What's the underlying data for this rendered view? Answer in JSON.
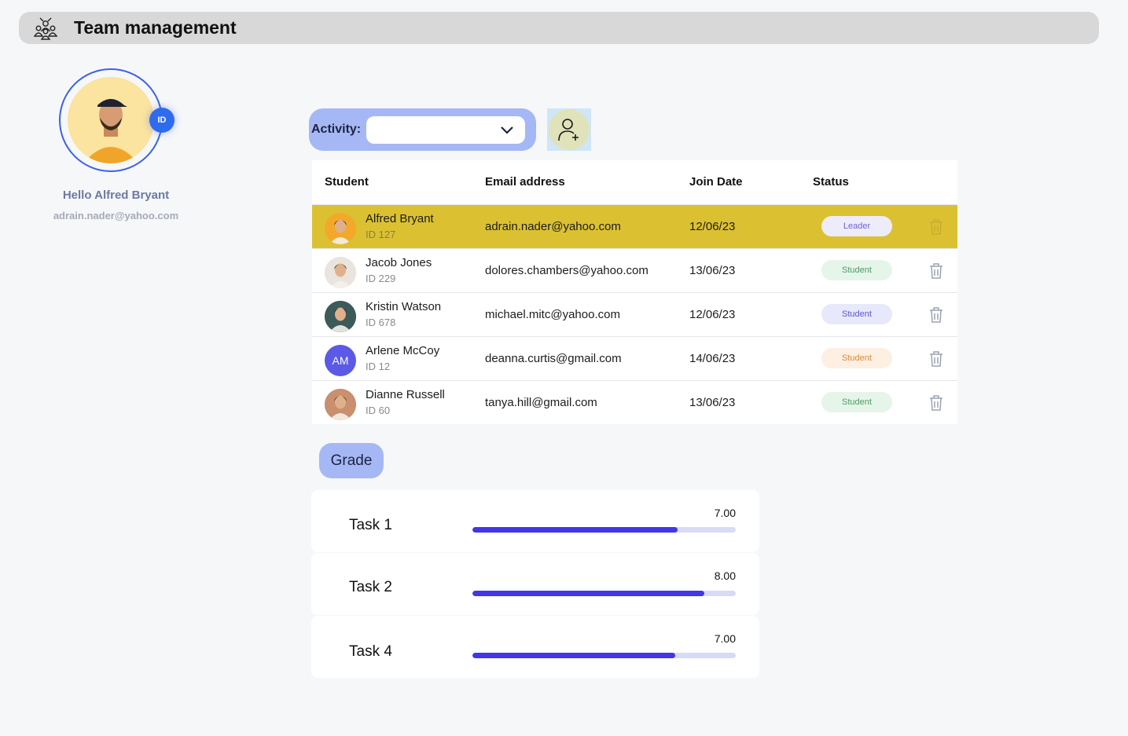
{
  "header": {
    "title": "Team management",
    "icon": "team-icon"
  },
  "profile": {
    "badge": "ID",
    "greeting": "Hello Alfred Bryant",
    "email": "adrain.nader@yahoo.com"
  },
  "activity": {
    "label": "Activity:",
    "value": ""
  },
  "table": {
    "headers": {
      "student": "Student",
      "email": "Email address",
      "date": "Join Date",
      "status": "Status"
    },
    "rows": [
      {
        "name": "Alfred Bryant",
        "id": "ID 127",
        "email": "adrain.nader@yahoo.com",
        "date": "12/06/23",
        "status": "Leader",
        "status_bg": "#eeecfb",
        "status_fg": "#6b63d6",
        "avatar": "photo",
        "avatar_bg": "#f2a92a",
        "initials": ""
      },
      {
        "name": "Jacob Jones",
        "id": "ID 229",
        "email": "dolores.chambers@yahoo.com",
        "date": "13/06/23",
        "status": "Student",
        "status_bg": "#e6f5ea",
        "status_fg": "#4f9a62",
        "avatar": "photo",
        "avatar_bg": "#e9e4de",
        "initials": ""
      },
      {
        "name": "Kristin Watson",
        "id": "ID 678",
        "email": "michael.mitc@yahoo.com",
        "date": "12/06/23",
        "status": "Student",
        "status_bg": "#e8e8fb",
        "status_fg": "#5a55cf",
        "avatar": "photo",
        "avatar_bg": "#3c5a5a",
        "initials": ""
      },
      {
        "name": "Arlene McCoy",
        "id": "ID 12",
        "email": "deanna.curtis@gmail.com",
        "date": "14/06/23",
        "status": "Student",
        "status_bg": "#fdf0e2",
        "status_fg": "#d78a3c",
        "avatar": "initials",
        "avatar_bg": "#5b5ae6",
        "initials": "AM"
      },
      {
        "name": "Dianne Russell",
        "id": "ID 60",
        "email": "tanya.hill@gmail.com",
        "date": "13/06/23",
        "status": "Student",
        "status_bg": "#e6f5ea",
        "status_fg": "#4f9a62",
        "avatar": "photo",
        "avatar_bg": "#c98f6e",
        "initials": ""
      }
    ]
  },
  "grade": {
    "label": "Grade",
    "tasks": [
      {
        "name": "Task 1",
        "value": "7.00",
        "progress": 0.78
      },
      {
        "name": "Task 2",
        "value": "8.00",
        "progress": 0.88
      },
      {
        "name": "Task 4",
        "value": "7.00",
        "progress": 0.77
      }
    ]
  },
  "colors": {
    "accent": "#3b62e6",
    "highlight_row": "#dbc132",
    "progress": "#4236e6",
    "pill": "#a5b8f5"
  }
}
